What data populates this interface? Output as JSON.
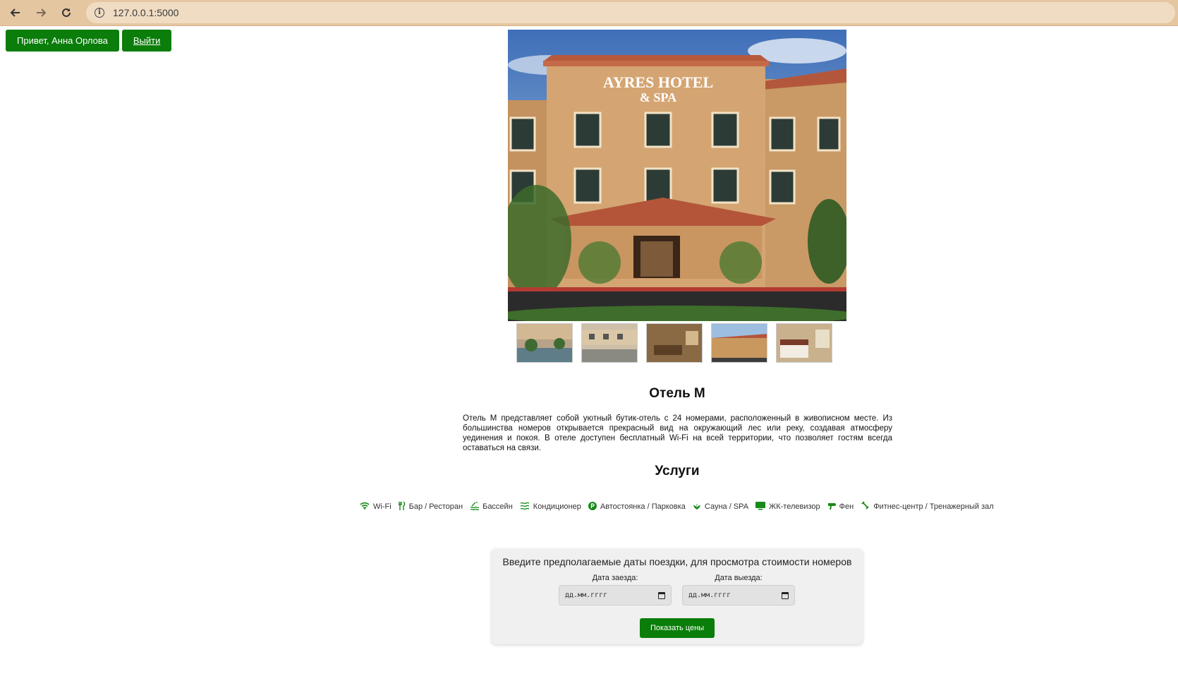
{
  "browser": {
    "url": "127.0.0.1:5000",
    "back_icon": "arrow-left",
    "forward_icon": "arrow-right",
    "reload_icon": "reload"
  },
  "userbar": {
    "greeting": "Привет, Анна Орлова",
    "logout": "Выйти"
  },
  "hotel": {
    "sign_line1": "AYRES HOTEL",
    "sign_line2": "& SPA",
    "title": "Отель М",
    "description": "Отель М представляет собой уютный бутик-отель с 24 номерами, расположенный в живописном месте. Из большинства номеров открывается прекрасный вид на окружающий лес или реку, создавая атмосферу уединения и покоя. В отеле доступен бесплатный Wi-Fi на всей территории, что позволяет гостям всегда оставаться на связи."
  },
  "services": {
    "title": "Услуги",
    "items": [
      {
        "label": "Wi-Fi",
        "icon": "wifi-icon"
      },
      {
        "label": "Бар / Ресторан",
        "icon": "restaurant-icon"
      },
      {
        "label": "Бассейн",
        "icon": "pool-icon"
      },
      {
        "label": "Кондиционер",
        "icon": "air-conditioner-icon"
      },
      {
        "label": "Автостоянка / Парковка",
        "icon": "parking-icon"
      },
      {
        "label": "Сауна / SPA",
        "icon": "spa-icon"
      },
      {
        "label": "ЖК-телевизор",
        "icon": "tv-icon"
      },
      {
        "label": "Фен",
        "icon": "hairdryer-icon"
      },
      {
        "label": "Фитнес-центр / Тренажерный зал",
        "icon": "fitness-icon"
      }
    ]
  },
  "booking": {
    "prompt": "Введите предполагаемые даты поездки, для просмотра стоимости номеров",
    "checkin_label": "Дата заезда:",
    "checkout_label": "Дата выезда:",
    "checkin_placeholder": "дд.мм.гггг",
    "checkout_placeholder": "дд.мм.гггг",
    "submit": "Показать цены"
  },
  "colors": {
    "accent": "#0a7d0a",
    "chrome": "#e4c6a0"
  }
}
